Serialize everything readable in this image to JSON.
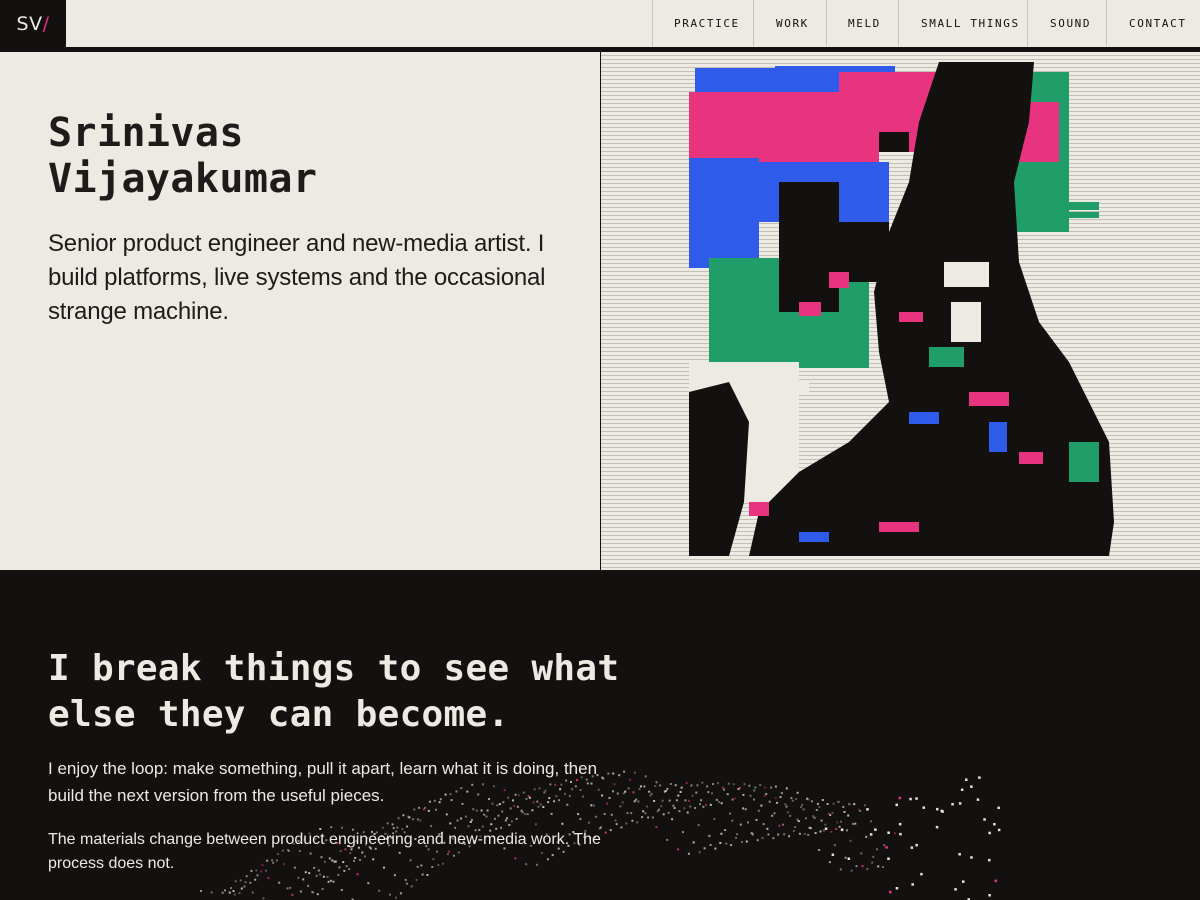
{
  "header": {
    "logo": {
      "text": "SV",
      "slash": "/"
    },
    "nav": [
      {
        "label": "PRACTICE",
        "icon": ""
      },
      {
        "label": "WORK"
      },
      {
        "label": "MELD"
      },
      {
        "label": "SMALL THINGS"
      },
      {
        "label": "SOUND"
      },
      {
        "label": "CONTACT"
      }
    ]
  },
  "hero": {
    "name_line1": "Srinivas",
    "name_line2": "Vijayakumar",
    "tagline": "Senior product engineer and new-media artist. I build platforms, live systems and the occasional strange machine.",
    "portrait_icon": "glitch-portrait-image"
  },
  "about": {
    "headline_line1": "I break things to see what",
    "headline_line2": "else they can become.",
    "paragraph1": "I enjoy the loop: make something, pull it apart, learn what it is doing, then build the next version from the useful pieces.",
    "paragraph2": "The materials change between product engineering and new-media work. The process does not."
  },
  "colors": {
    "paper": "#edeae3",
    "ink": "#131110",
    "accent_pink": "#e8337e",
    "accent_blue": "#2f5bea",
    "accent_green": "#1f9e6a"
  }
}
